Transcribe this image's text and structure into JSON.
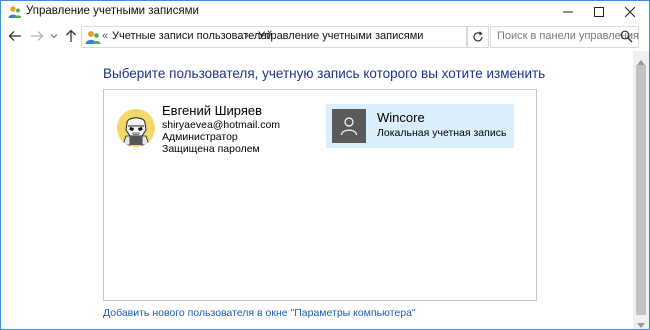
{
  "window": {
    "title": "Управление учетными записями",
    "app_icon": "user-accounts-icon"
  },
  "navigation": {
    "breadcrumb_overflow": "«",
    "breadcrumbs": [
      "Учетные записи пользователей",
      "Управление учетными записями"
    ],
    "separator": "›",
    "search_placeholder": "Поиск в панели управления"
  },
  "content": {
    "heading": "Выберите пользователя, учетную запись которого вы хотите изменить",
    "users": [
      {
        "name": "Евгений Ширяев",
        "email": "shiryaevea@hotmail.com",
        "role": "Администратор",
        "status": "Защищена паролем",
        "avatar": "stormtrooper-avatar"
      },
      {
        "name": "Wincore",
        "account_type": "Локальная учетная запись",
        "avatar": "default-user-avatar",
        "selected": true
      }
    ],
    "add_user_link": "Добавить нового пользователя в окне \"Параметры компьютера\""
  },
  "colors": {
    "heading": "#1e3287",
    "link": "#1e5ab4",
    "selected_bg": "#dbeefb",
    "window_border": "#3c8ed6"
  }
}
